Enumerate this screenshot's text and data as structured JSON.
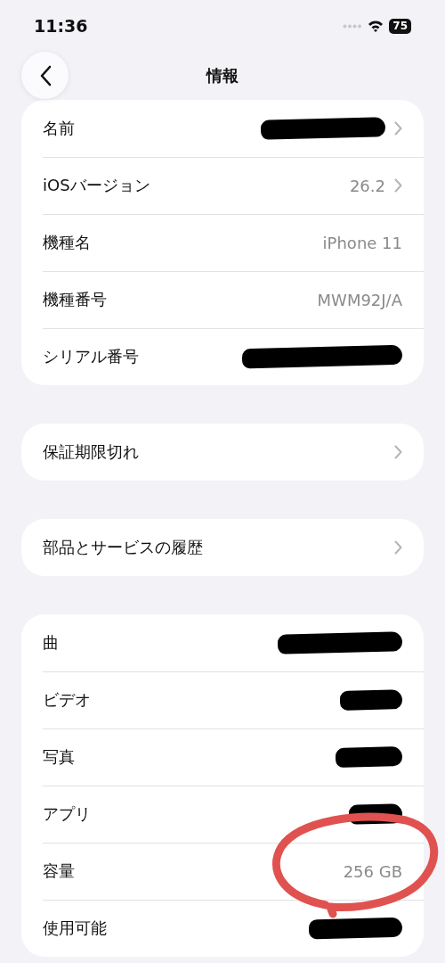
{
  "status_bar": {
    "time": "11:36",
    "battery": "75"
  },
  "nav": {
    "title": "情報"
  },
  "groups": [
    {
      "rows": [
        {
          "label": "名前",
          "redacted": true,
          "chevron": true
        },
        {
          "label": "iOSバージョン",
          "value": "26.2",
          "redacted": false,
          "chevron": true
        },
        {
          "label": "機種名",
          "value": "iPhone 11",
          "redacted": false,
          "chevron": false
        },
        {
          "label": "機種番号",
          "value": "MWM92J/A",
          "redacted": false,
          "chevron": false
        },
        {
          "label": "シリアル番号",
          "redacted": true,
          "chevron": false
        }
      ]
    },
    {
      "rows": [
        {
          "label": "保証期限切れ",
          "redacted": false,
          "chevron": true
        }
      ]
    },
    {
      "rows": [
        {
          "label": "部品とサービスの履歴",
          "redacted": false,
          "chevron": true
        }
      ]
    },
    {
      "rows": [
        {
          "label": "曲",
          "redacted": true,
          "chevron": false
        },
        {
          "label": "ビデオ",
          "redacted": true,
          "chevron": false
        },
        {
          "label": "写真",
          "redacted": true,
          "chevron": false
        },
        {
          "label": "アプリ",
          "redacted": true,
          "chevron": false
        },
        {
          "label": "容量",
          "value": "256 GB",
          "redacted": false,
          "chevron": false
        },
        {
          "label": "使用可能",
          "redacted": true,
          "chevron": false
        }
      ]
    }
  ],
  "annotation": {
    "kind": "circle"
  }
}
